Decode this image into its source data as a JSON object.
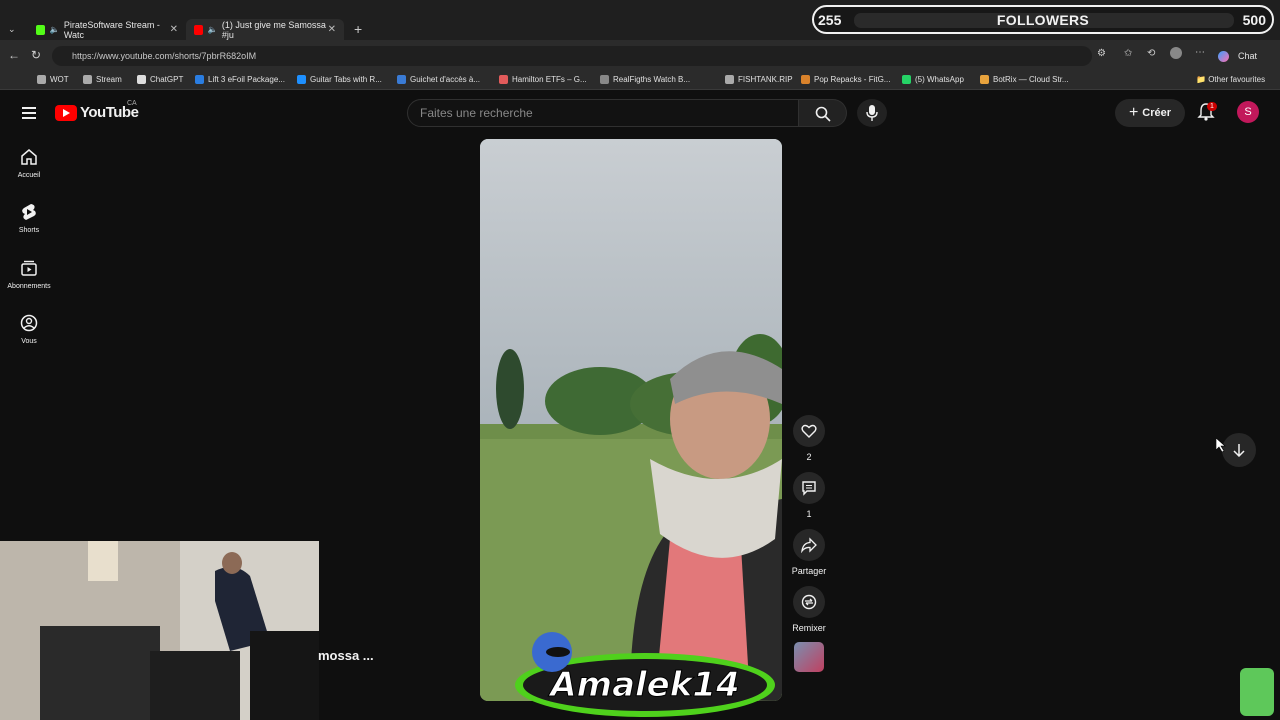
{
  "browser": {
    "tabs": [
      {
        "label": "PirateSoftware Stream - Watc",
        "active": false,
        "fav_color": "#53fc18"
      },
      {
        "label": "(1) Just give me Samossa #ju",
        "active": true,
        "fav_color": "#ff0000"
      }
    ],
    "url": "https://www.youtube.com/shorts/7pbrR682oIM",
    "chat_label": "Chat",
    "bookmarks": [
      "WOT",
      "Stream",
      "ChatGPT",
      "Lift 3 eFoil Package...",
      "Guitar Tabs with R...",
      "Guichet d'accès à...",
      "Hamilton ETFs – G...",
      "RealFigths Watch B...",
      "FISHTANK.RIP",
      "Pop Repacks - FitG...",
      "(5) WhatsApp",
      "BotRix — Cloud Str..."
    ],
    "other_favourites": "Other favourites"
  },
  "followers": {
    "current": "255",
    "label": "FOLLOWERS",
    "goal": "500",
    "progress": 0.51
  },
  "youtube": {
    "logo_text": "YouTube",
    "country": "CA",
    "search_placeholder": "Faites une recherche",
    "create_label": "Créer",
    "notif_count": "1",
    "avatar_letter": "S",
    "sidebar": [
      {
        "label": "Accueil",
        "icon": "home-icon"
      },
      {
        "label": "Shorts",
        "icon": "shorts-icon"
      },
      {
        "label": "Abonnements",
        "icon": "subscriptions-icon"
      },
      {
        "label": "Vous",
        "icon": "you-icon"
      }
    ],
    "actions": {
      "likes": "2",
      "comments": "1",
      "share": "Partager",
      "remix": "Remixer"
    },
    "title_fragment": "mossa ..."
  },
  "colors": {
    "accent": "#ff0000",
    "bg": "#0f0f0f"
  }
}
